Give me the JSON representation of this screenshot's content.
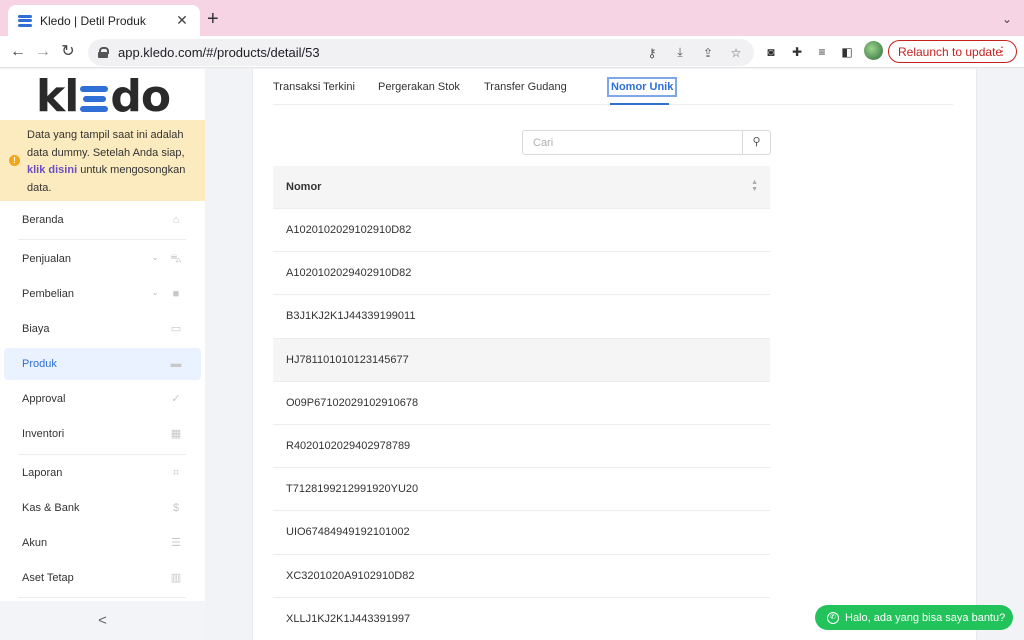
{
  "browser": {
    "tab_title": "Kledo | Detil Produk",
    "tab_close": "✕",
    "new_tab": "+",
    "tab_menu": "⌄",
    "url": "app.kledo.com/#/products/detail/53",
    "relaunch_label": "Relaunch to update",
    "relaunch_menu": "⋮",
    "nav": {
      "back": "←",
      "forward": "→",
      "reload": "↻"
    },
    "omni_icons": [
      "key-icon",
      "download-icon",
      "share-icon",
      "star-icon"
    ],
    "omni_glyphs": [
      "⚷",
      "⤓",
      "⇪",
      "☆"
    ],
    "ext_glyphs": [
      "◙",
      "✚",
      "≡",
      "◧"
    ]
  },
  "sidebar": {
    "logo": {
      "k": "kl",
      "tail": "do"
    },
    "notice": {
      "text_before": "Data yang tampil saat ini adalah data dummy. Setelah Anda siap, ",
      "link": "klik disini",
      "text_after": " untuk mengosongkan data.",
      "warn_glyph": "!"
    },
    "items": [
      {
        "label": "Beranda",
        "icon": "home-icon",
        "glyph": "⌂"
      },
      {
        "label": "Penjualan",
        "icon": "basket-icon",
        "glyph": "⛍",
        "chevron": "⌄"
      },
      {
        "label": "Pembelian",
        "icon": "bag-icon",
        "glyph": "■",
        "chevron": "⌄"
      },
      {
        "label": "Biaya",
        "icon": "card-icon",
        "glyph": "▭"
      },
      {
        "label": "Produk",
        "icon": "box-icon",
        "glyph": "▬"
      },
      {
        "label": "Approval",
        "icon": "check-icon",
        "glyph": "✓"
      },
      {
        "label": "Inventori",
        "icon": "warehouse-icon",
        "glyph": "▦"
      },
      {
        "label": "Laporan",
        "icon": "chart-icon",
        "glyph": "⌗"
      },
      {
        "label": "Kas & Bank",
        "icon": "dollar-icon",
        "glyph": "$"
      },
      {
        "label": "Akun",
        "icon": "ledger-icon",
        "glyph": "☰"
      },
      {
        "label": "Aset Tetap",
        "icon": "building-icon",
        "glyph": "▥"
      }
    ],
    "collapse_glyph": "<"
  },
  "content": {
    "tabs": [
      "Transaksi Terkini",
      "Pergerakan Stok",
      "Transfer Gudang",
      "Nomor Unik"
    ],
    "active_tab": 3,
    "search": {
      "placeholder": "Cari",
      "value": "",
      "button_glyph": "⚲"
    },
    "table": {
      "header": "Nomor",
      "sort_glyph_up": "▲",
      "sort_glyph_down": "▼",
      "rows": [
        "A1020102029102910D82",
        "A1020102029402910D82",
        "B3J1KJ2K1J44339199011",
        "HJ781101010123145677",
        "O09P67102029102910678",
        "R4020102029402978789",
        "T7128199212991920YU20",
        "UIO67484949192101002",
        "XC3201020A9102910D82",
        "XLLJ1KJ2K1J443391997"
      ]
    }
  },
  "chat": {
    "label": "Halo, ada yang bisa saya bantu?",
    "glyph": "✆"
  },
  "colors": {
    "accent": "#2f6fd6",
    "notice_bg": "#fcebbf",
    "chat": "#22c35a",
    "relaunch": "#c5221f",
    "tabbar": "#f7d4e3"
  }
}
